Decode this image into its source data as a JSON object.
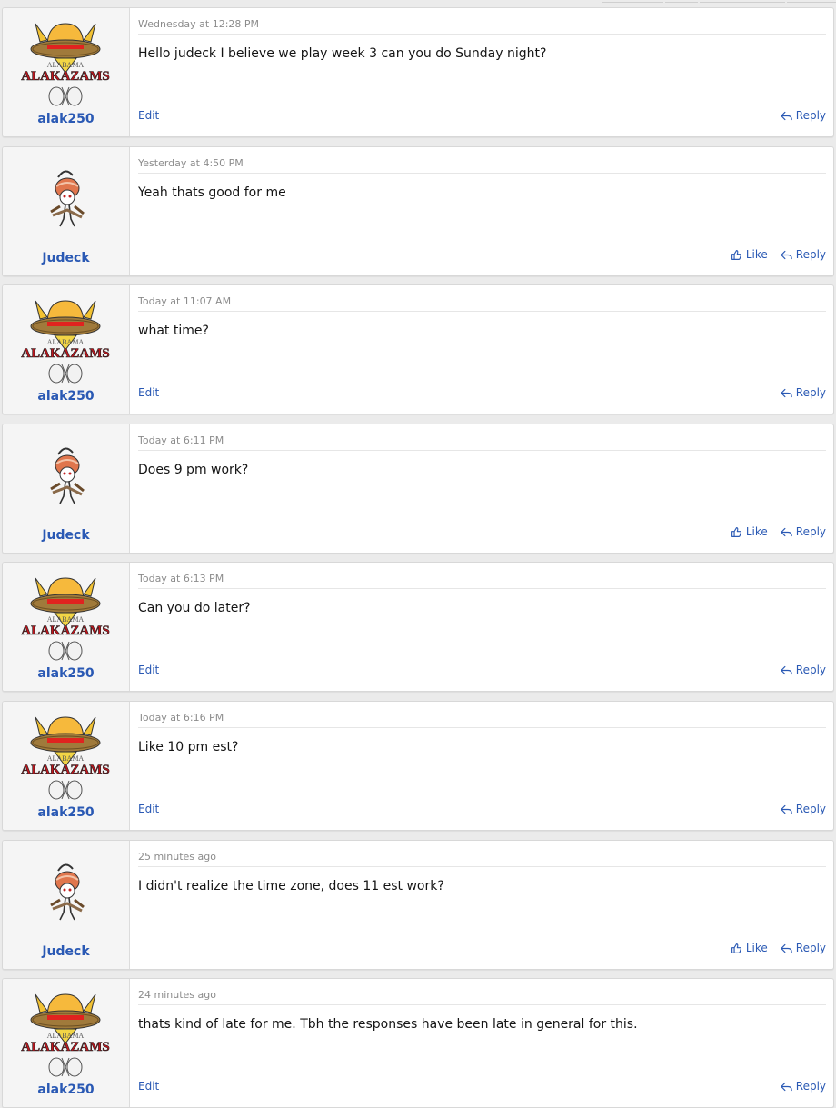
{
  "posts": [
    {
      "author": "alak250",
      "avatar": "alakazams-logo",
      "logo_text": "ALAKAZAMS",
      "timestamp": "Wednesday at 12:28 PM",
      "body": "Hello judeck I believe we play week 3 can you do Sunday night?",
      "own": true,
      "edit_label": "Edit",
      "reply_label": "Reply"
    },
    {
      "author": "Judeck",
      "avatar": "character-avatar",
      "timestamp": "Yesterday at 4:50 PM",
      "body": "Yeah thats good for me",
      "own": false,
      "like_label": "Like",
      "reply_label": "Reply"
    },
    {
      "author": "alak250",
      "avatar": "alakazams-logo",
      "logo_text": "ALAKAZAMS",
      "timestamp": "Today at 11:07 AM",
      "body": "what time?",
      "own": true,
      "edit_label": "Edit",
      "reply_label": "Reply"
    },
    {
      "author": "Judeck",
      "avatar": "character-avatar",
      "timestamp": "Today at 6:11 PM",
      "body": "Does 9 pm work?",
      "own": false,
      "like_label": "Like",
      "reply_label": "Reply"
    },
    {
      "author": "alak250",
      "avatar": "alakazams-logo",
      "logo_text": "ALAKAZAMS",
      "timestamp": "Today at 6:13 PM",
      "body": "Can you do later?",
      "own": true,
      "edit_label": "Edit",
      "reply_label": "Reply"
    },
    {
      "author": "alak250",
      "avatar": "alakazams-logo",
      "logo_text": "ALAKAZAMS",
      "timestamp": "Today at 6:16 PM",
      "body": "Like 10 pm est?",
      "own": true,
      "edit_label": "Edit",
      "reply_label": "Reply"
    },
    {
      "author": "Judeck",
      "avatar": "character-avatar",
      "timestamp": "25 minutes ago",
      "body": "I didn't realize the time zone, does 11 est work?",
      "own": false,
      "like_label": "Like",
      "reply_label": "Reply"
    },
    {
      "author": "alak250",
      "avatar": "alakazams-logo",
      "logo_text": "ALAKAZAMS",
      "timestamp": "24 minutes ago",
      "body": "thats kind of late for me. Tbh the responses have been late in general for this.",
      "own": true,
      "edit_label": "Edit",
      "reply_label": "Reply"
    }
  ],
  "colors": {
    "link": "#2a59b4",
    "username": "#2a59b4",
    "timestamp": "#8c8c8c",
    "body": "#141414",
    "page_bg": "#ebebeb",
    "user_col_bg": "#f5f5f5"
  },
  "icons": {
    "like": "thumbs-up-icon",
    "reply": "reply-arrow-icon"
  }
}
